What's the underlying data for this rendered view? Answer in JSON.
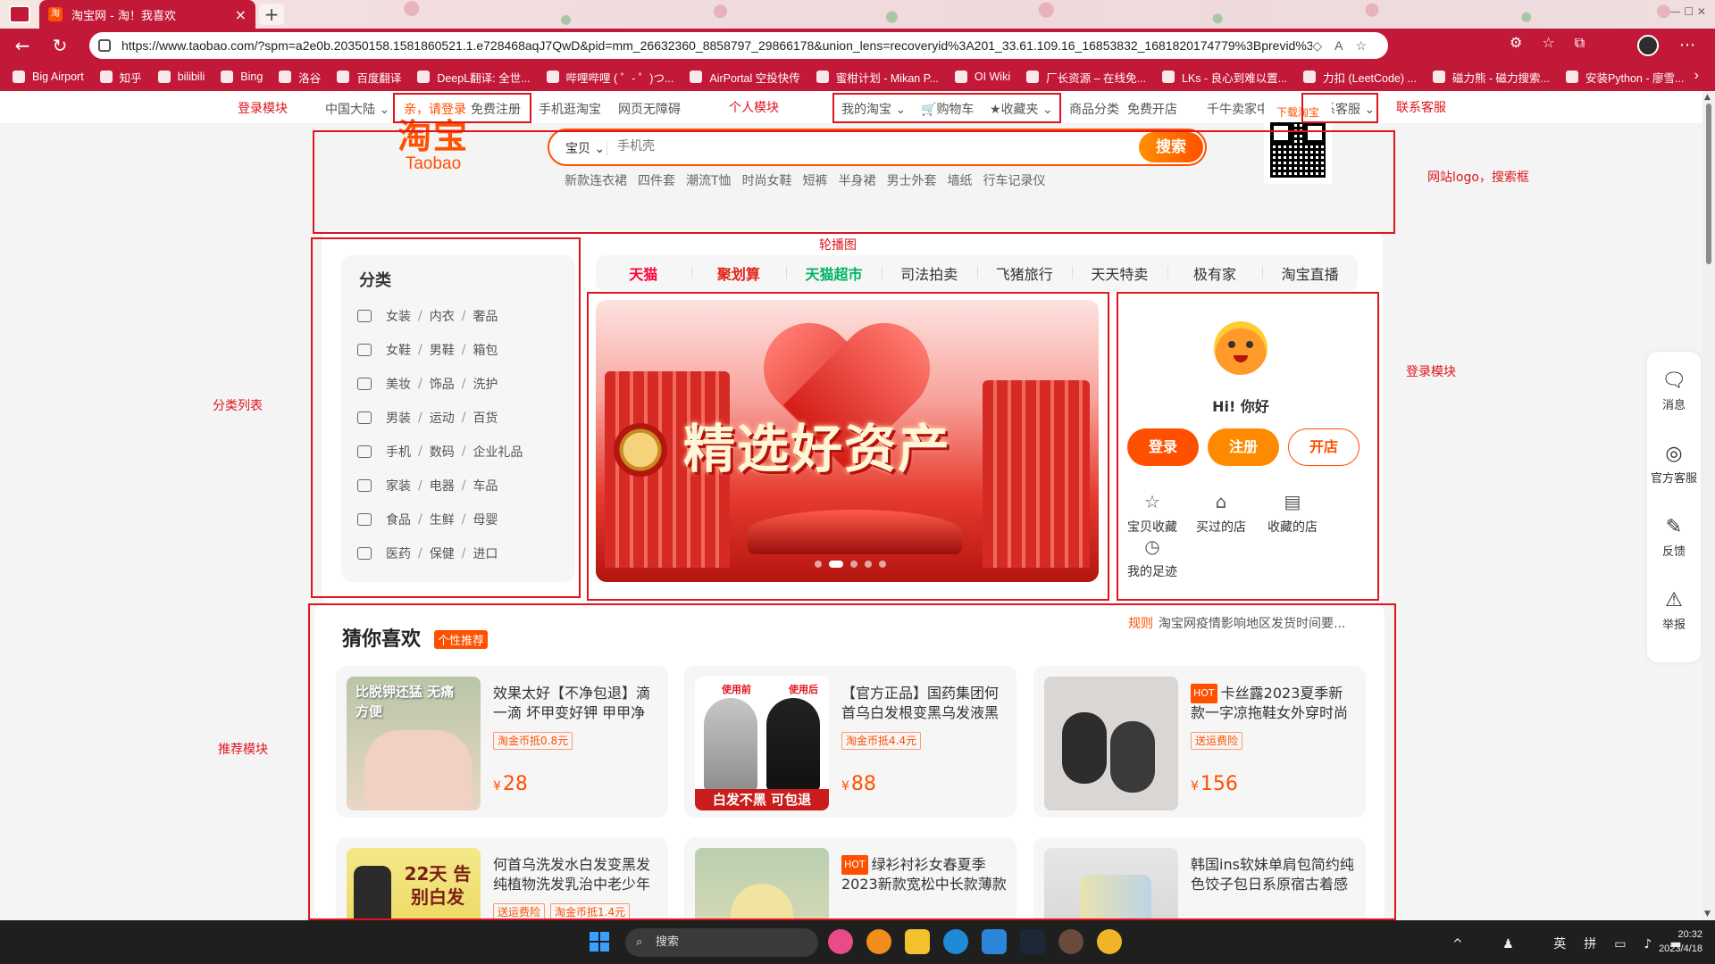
{
  "browser": {
    "tab_title": "淘宝网 - 淘！我喜欢",
    "tab_favicon": "淘",
    "tab_close": "×",
    "new_tab": "+",
    "url": "https://www.taobao.com/?spm=a2e0b.20350158.1581860521.1.e728468aqJ7QwD&pid=mm_26632360_8858797_29866178&union_lens=recoveryid%3A201_33.61.109.16_16853832_1681820174779%3Bprevid%3A201_33.6...",
    "bookmarks": [
      "Big Airport",
      "知乎",
      "bilibili",
      "Bing",
      "洛谷",
      "百度翻译",
      "DeepL翻译: 全世...",
      "哔哩哔哩 ( ゜- ゜)つ...",
      "AirPortal 空投快传",
      "蜜柑计划 - Mikan P...",
      "OI Wiki",
      "厂长资源 – 在线免...",
      "LKs - 良心到难以置...",
      "力扣 (LeetCode) ...",
      "磁力熊 - 磁力搜索...",
      "安装Python - 廖雪..."
    ]
  },
  "topnav": {
    "region": "中国大陆",
    "login_link": "亲，请登录",
    "register_link": "免费注册",
    "mobile": "手机逛淘宝",
    "accessible": "网页无障碍",
    "my_taobao": "我的淘宝",
    "cart": "购物车",
    "favorites": "收藏夹",
    "categories": "商品分类",
    "open_store": "免费开店",
    "seller_center": "千牛卖家中心",
    "customer_service": "联系客服"
  },
  "annotations": {
    "login_module": "登录模块",
    "personal_module": "个人模块",
    "contact_service": "联系客服",
    "logo_search": "网站logo，搜索框",
    "carousel": "轮播图",
    "category_list": "分类列表",
    "login_module_2": "登录模块",
    "recommend_module": "推荐模块"
  },
  "header": {
    "logo_cn": "淘宝",
    "logo_en": "Taobao",
    "search_type": "宝贝",
    "search_placeholder": "手机壳",
    "search_button": "搜索",
    "hot_words": [
      "新款连衣裙",
      "四件套",
      "潮流T恤",
      "时尚女鞋",
      "短裤",
      "半身裙",
      "男士外套",
      "墙纸",
      "行车记录仪"
    ],
    "download_label": "下载淘宝"
  },
  "categories": {
    "title": "分类",
    "rows": [
      [
        "女装",
        "内衣",
        "奢品"
      ],
      [
        "女鞋",
        "男鞋",
        "箱包"
      ],
      [
        "美妆",
        "饰品",
        "洗护"
      ],
      [
        "男装",
        "运动",
        "百货"
      ],
      [
        "手机",
        "数码",
        "企业礼品"
      ],
      [
        "家装",
        "电器",
        "车品"
      ],
      [
        "食品",
        "生鲜",
        "母婴"
      ],
      [
        "医药",
        "保健",
        "进口"
      ]
    ],
    "separator": "/"
  },
  "channel_tabs": [
    "天猫",
    "聚划算",
    "天猫超市",
    "司法拍卖",
    "飞猪旅行",
    "天天特卖",
    "极有家",
    "淘宝直播"
  ],
  "banner": {
    "headline": "精选好资产",
    "slides": 5,
    "active_slide": 2
  },
  "user_panel": {
    "greeting": "Hi! 你好",
    "login": "登录",
    "register": "注册",
    "open_store": "开店",
    "links": [
      "宝贝收藏",
      "买过的店",
      "收藏的店",
      "我的足迹"
    ]
  },
  "recommend": {
    "title": "猜你喜欢",
    "badge": "个性推荐",
    "notice_tag": "规则",
    "notice_text": "淘宝网疫情影响地区发货时间要...",
    "products": [
      {
        "name": "效果太好【不净包退】滴一滴 坏甲变好钾 甲甲净",
        "tags": [
          "淘金币抵0.8元"
        ],
        "currency": "¥",
        "price": "28",
        "hot": false,
        "img_caption": "比脱钾还猛 无痛 方便"
      },
      {
        "name": "【官方正品】国药集团何首乌白发根变黑乌发液黑",
        "tags": [
          "淘金币抵4.4元"
        ],
        "currency": "¥",
        "price": "88",
        "hot": false,
        "img_caption": "白发不黑 可包退",
        "img_labels": [
          "使用前",
          "使用后"
        ]
      },
      {
        "name": "卡丝露2023夏季新款一字凉拖鞋女外穿时尚百",
        "tags": [
          "送运费险"
        ],
        "currency": "¥",
        "price": "156",
        "hot": true
      },
      {
        "name": "何首乌洗发水白发变黑发纯植物洗发乳治中老少年",
        "tags": [
          "送运费险",
          "淘金币抵1.4元"
        ],
        "currency": "¥",
        "price": "",
        "hot": false,
        "img_caption": "22天 告别白发"
      },
      {
        "name": "绿衫衬衫女春夏季2023新款宽松中长款薄款",
        "tags": [],
        "currency": "¥",
        "price": "",
        "hot": true
      },
      {
        "name": "韩国ins软妹单肩包简约纯色饺子包日系原宿古着感",
        "tags": [],
        "currency": "¥",
        "price": "",
        "hot": false
      }
    ],
    "hot_label": "HOT"
  },
  "side_float": [
    "消息",
    "官方客服",
    "反馈",
    "举报"
  ],
  "taskbar": {
    "search": "搜索",
    "ime_lang": "英",
    "ime_mode": "拼",
    "time": "20:32",
    "date": "2023/4/18"
  }
}
